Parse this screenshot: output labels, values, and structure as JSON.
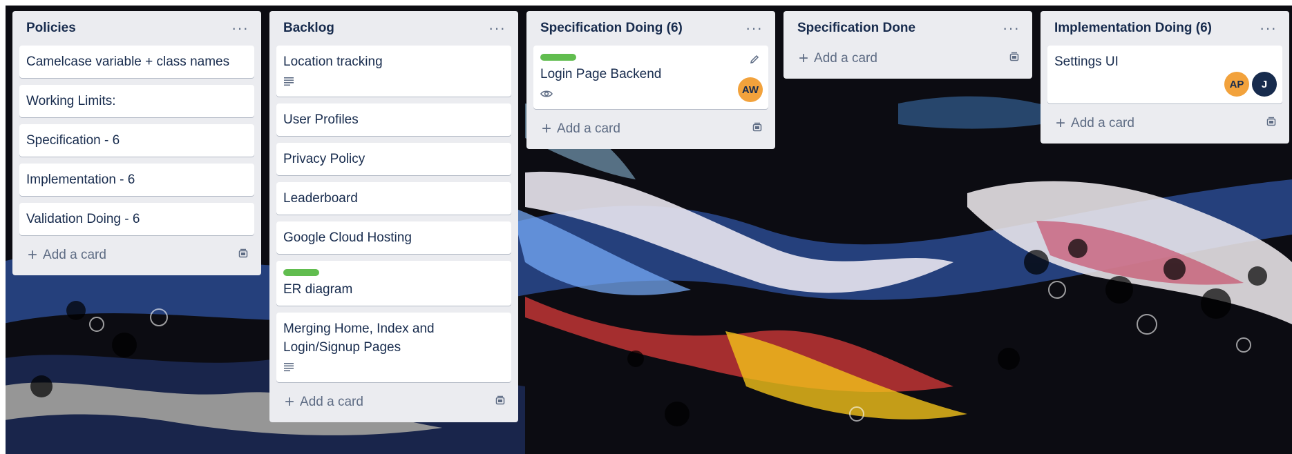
{
  "board": {
    "lists": [
      {
        "title": "Policies",
        "cards": [
          {
            "title": "Camelcase variable + class names"
          },
          {
            "title": "Working Limits:"
          },
          {
            "title": "Specification - 6"
          },
          {
            "title": "Implementation - 6"
          },
          {
            "title": "Validation Doing - 6"
          }
        ],
        "add_label": "Add a card"
      },
      {
        "title": "Backlog",
        "cards": [
          {
            "title": "Location tracking",
            "has_description": true
          },
          {
            "title": "User Profiles"
          },
          {
            "title": "Privacy Policy"
          },
          {
            "title": "Leaderboard"
          },
          {
            "title": "Google Cloud Hosting"
          },
          {
            "title": "ER diagram",
            "label_color": "#61bd4f"
          },
          {
            "title": "Merging Home, Index and Login/Signup Pages",
            "has_description": true
          }
        ],
        "add_label": "Add a card"
      },
      {
        "title": "Specification Doing (6)",
        "cards": [
          {
            "title": "Login Page Backend",
            "label_color": "#61bd4f",
            "watching": true,
            "members": [
              "AW"
            ]
          }
        ],
        "add_label": "Add a card"
      },
      {
        "title": "Specification Done",
        "cards": [],
        "add_label": "Add a card"
      },
      {
        "title": "Implementation Doing (6)",
        "cards": [
          {
            "title": "Settings UI",
            "members": [
              "AP",
              "J"
            ]
          }
        ],
        "add_label": "Add a card"
      }
    ]
  },
  "colors": {
    "label_green": "#61bd4f",
    "list_bg": "#ebecf0",
    "avatar_orange": "#f2a23c",
    "avatar_navy": "#172b4d"
  },
  "icons": [
    "more-icon",
    "description-icon",
    "eye-icon",
    "pencil-icon",
    "plus-icon",
    "template-icon"
  ]
}
